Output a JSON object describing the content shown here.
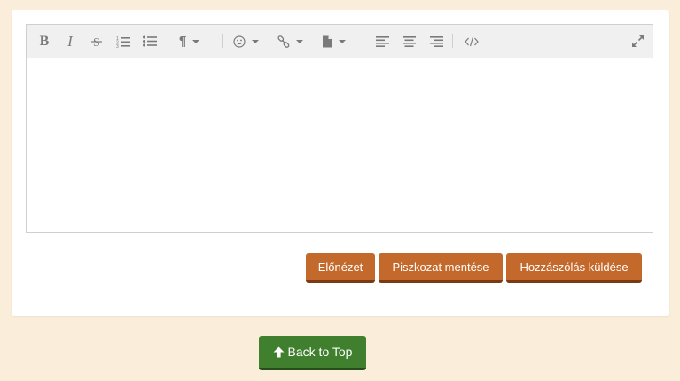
{
  "toolbar": {
    "items": [
      {
        "icon": "bold-icon"
      },
      {
        "icon": "italic-icon"
      },
      {
        "icon": "strikethrough-icon"
      },
      {
        "icon": "ordered-list-icon"
      },
      {
        "icon": "unordered-list-icon"
      },
      {
        "icon": "paragraph-icon"
      },
      {
        "icon": "emoji-icon"
      },
      {
        "icon": "link-icon"
      },
      {
        "icon": "insert-file-icon"
      },
      {
        "icon": "align-left-icon"
      },
      {
        "icon": "align-center-icon"
      },
      {
        "icon": "align-right-icon"
      },
      {
        "icon": "code-view-icon"
      },
      {
        "icon": "fullscreen-icon"
      }
    ]
  },
  "editor": {
    "value": ""
  },
  "actions": {
    "preview_label": "Előnézet",
    "save_draft_label": "Piszkozat mentése",
    "submit_label": "Hozzászólás küldése"
  },
  "back_to_top": {
    "label": "Back to Top",
    "icon": "arrow-up-icon"
  },
  "colors": {
    "page_bg": "#faeedb",
    "action_button": "#c4692c",
    "back_to_top_button": "#3f7f2e"
  }
}
